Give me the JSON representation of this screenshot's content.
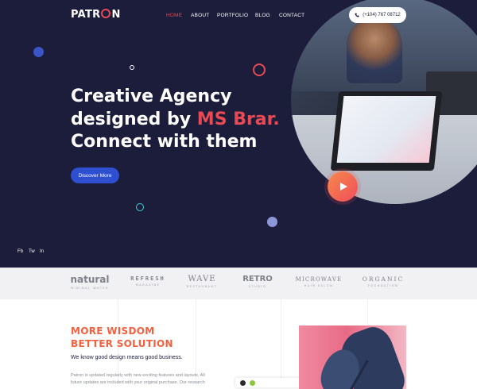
{
  "header": {
    "logo": {
      "before": "PATR",
      "after": "N"
    },
    "nav": [
      {
        "label": "HOME",
        "active": true
      },
      {
        "label": "ABOUT",
        "active": false
      },
      {
        "label": "PORTFOLIO",
        "active": false
      },
      {
        "label": "BLOG",
        "active": false
      },
      {
        "label": "CONTACT",
        "active": false
      }
    ],
    "phone": {
      "icon": "phone-icon",
      "label": "(+104) 767 08712"
    }
  },
  "hero": {
    "headline": {
      "line1": "Creative Agency",
      "line2_prefix": "designed by ",
      "line2_accent": "MS Brar.",
      "line3": "Connect with them"
    },
    "cta_label": "Discover More",
    "video": {
      "icon": "play-icon"
    },
    "social": [
      "Fb",
      "Tw",
      "In"
    ]
  },
  "brands": [
    {
      "name": "natural",
      "sub": "MINIMAL WATER"
    },
    {
      "name": "REFRESH",
      "sub": "MAGAZINE"
    },
    {
      "name": "WAVE",
      "sub": "RESTAURANT"
    },
    {
      "name": "RETRO",
      "sub": "STUDIO"
    },
    {
      "name": "MICROWAVE",
      "sub": "HAIR SALON"
    },
    {
      "name": "ORGANIC",
      "sub": "FOUNDATION"
    }
  ],
  "about": {
    "title_line1": "MORE WISDOM",
    "title_line2": "BETTER SOLUTION",
    "tagline": "We know good design means good business.",
    "paragraph": "Patron is updated regularly with new exciting features and layouts. All future updates are included with your original purchase. Our research"
  },
  "colors": {
    "hero_bg": "#1b1d3a",
    "accent_red": "#e84a55",
    "accent_orange": "#f2613f",
    "button_blue": "#2f4fd1",
    "brand_strip_bg": "#f1f1f4"
  }
}
